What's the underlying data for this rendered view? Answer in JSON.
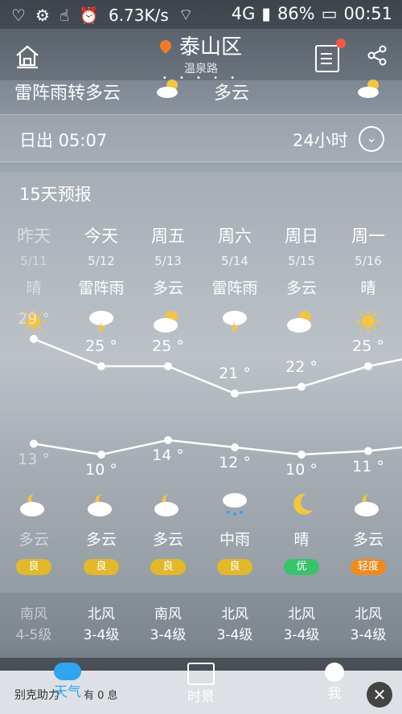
{
  "status": {
    "speed": "6.73K/s",
    "network": "4G",
    "battery": "86%",
    "time": "00:51"
  },
  "header": {
    "city": "泰山区",
    "street": "温泉路"
  },
  "now": {
    "left": "雷阵雨转多云",
    "right": "多云"
  },
  "sunrise": {
    "label": "日出 05:07",
    "hours": "24小时"
  },
  "forecast": {
    "title": "15天预报",
    "days": [
      {
        "day": "昨天",
        "date": "5/11",
        "day_cond": "晴",
        "high": "29 °",
        "low": "13 °",
        "night_cond": "多云",
        "aqi": "良",
        "aqi_color": "#e1b92b",
        "wind_dir": "南风",
        "wind_level": "4-5级",
        "day_icon": "sun-icon",
        "night_icon": "moon-cloud-icon"
      },
      {
        "day": "今天",
        "date": "5/12",
        "day_cond": "雷阵雨",
        "high": "25 °",
        "low": "10 °",
        "night_cond": "多云",
        "aqi": "良",
        "aqi_color": "#e1b92b",
        "wind_dir": "北风",
        "wind_level": "3-4级",
        "day_icon": "thunder-icon",
        "night_icon": "moon-cloud-icon"
      },
      {
        "day": "周五",
        "date": "5/13",
        "day_cond": "多云",
        "high": "25 °",
        "low": "14 °",
        "night_cond": "多云",
        "aqi": "良",
        "aqi_color": "#e1b92b",
        "wind_dir": "南风",
        "wind_level": "3-4级",
        "day_icon": "sun-cloud-icon",
        "night_icon": "moon-cloud-icon"
      },
      {
        "day": "周六",
        "date": "5/14",
        "day_cond": "雷阵雨",
        "high": "21 °",
        "low": "12 °",
        "night_cond": "中雨",
        "aqi": "良",
        "aqi_color": "#e1b92b",
        "wind_dir": "北风",
        "wind_level": "3-4级",
        "day_icon": "thunder-icon",
        "night_icon": "rain-icon"
      },
      {
        "day": "周日",
        "date": "5/15",
        "day_cond": "多云",
        "high": "22 °",
        "low": "10 °",
        "night_cond": "晴",
        "aqi": "优",
        "aqi_color": "#38c36a",
        "wind_dir": "北风",
        "wind_level": "3-4级",
        "day_icon": "sun-cloud-icon",
        "night_icon": "moon-icon"
      },
      {
        "day": "周一",
        "date": "5/16",
        "day_cond": "晴",
        "high": "25 °",
        "low": "11 °",
        "night_cond": "多云",
        "aqi": "轻度",
        "aqi_color": "#f08a1d",
        "wind_dir": "北风",
        "wind_level": "3-4级",
        "day_icon": "sun-icon",
        "night_icon": "moon-cloud-icon"
      }
    ]
  },
  "ad": {
    "text": "别克助力",
    "extra": "有 0 息"
  },
  "tabs": [
    {
      "label": "天气"
    },
    {
      "label": "时景"
    },
    {
      "label": "我"
    }
  ]
}
